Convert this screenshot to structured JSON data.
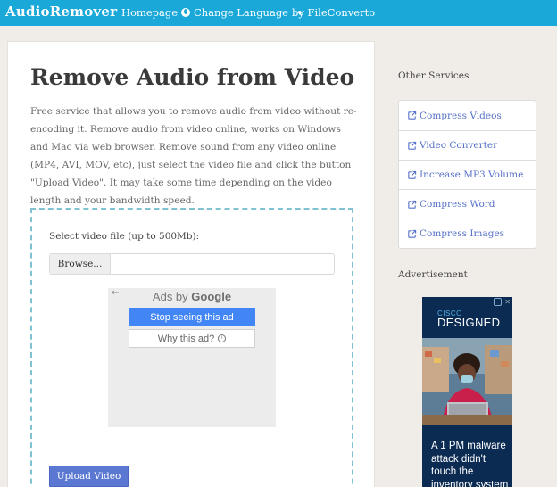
{
  "navbar": {
    "brand": "AudioRemover",
    "home": "Homepage",
    "language": "Change Language",
    "by": "by FileConverto"
  },
  "main": {
    "title": "Remove Audio from Video",
    "description": "Free service that allows you to remove audio from video without re-encoding it. Remove audio from video online, works on Windows and Mac via web browser. Remove sound from any video online (MP4, AVI, MOV, etc), just select the video file and click the button \"Upload Video\". It may take some time depending on the video length and your bandwidth speed.",
    "select_label": "Select video file (up to 500Mb):",
    "browse": "Browse...",
    "upload": "Upload Video"
  },
  "ad_overlay": {
    "ads_by": "Ads by",
    "google": "Google",
    "stop": "Stop seeing this ad",
    "why": "Why this ad?"
  },
  "sidebar": {
    "other_title": "Other Services",
    "services": [
      {
        "label": "Compress Videos"
      },
      {
        "label": "Video Converter"
      },
      {
        "label": "Increase MP3 Volume"
      },
      {
        "label": "Compress Word"
      },
      {
        "label": "Compress Images"
      }
    ],
    "adv_title": "Advertisement"
  },
  "cisco_ad": {
    "brand": "CISCO",
    "headline": "DESIGNED",
    "text": "A 1 PM malware attack didn't touch the inventory system"
  },
  "colors": {
    "navbar": "#1aa8d8",
    "link": "#5571c6",
    "button": "#5a78d1",
    "dropzone_border": "#7fc3d2"
  }
}
